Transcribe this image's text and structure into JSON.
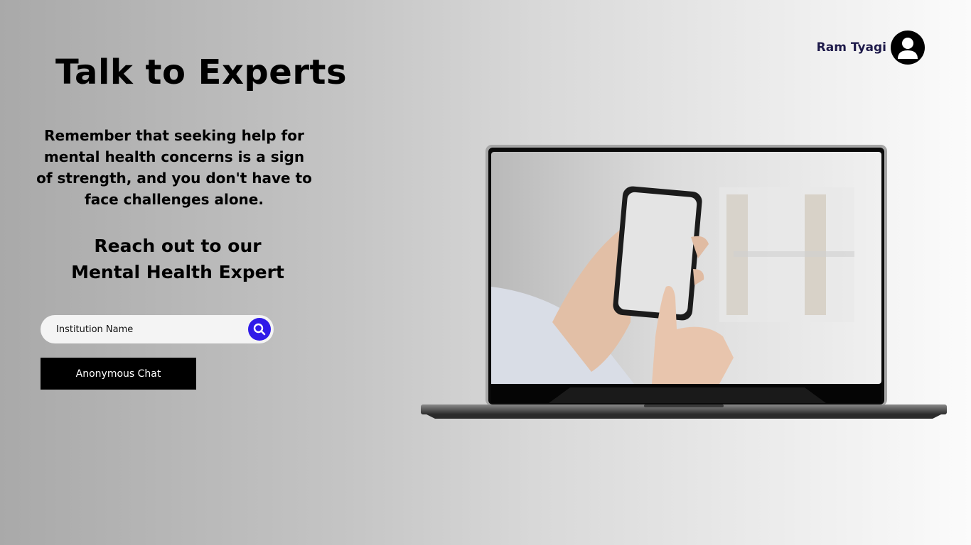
{
  "header": {
    "user_name": "Ram Tyagi",
    "avatar_icon": "user-icon"
  },
  "hero": {
    "title": "Talk to Experts",
    "intro": "Remember that seeking help for mental health concerns is a sign of strength, and you don't have to face challenges alone.",
    "reach_line1": "Reach out to our",
    "reach_line2": "Mental Health Expert"
  },
  "search": {
    "placeholder": "Institution Name",
    "icon": "search-icon",
    "accent": "#2f1ae8"
  },
  "actions": {
    "anonymous_chat_label": "Anonymous Chat"
  },
  "illustration": {
    "icon": "laptop-with-phone-image"
  }
}
